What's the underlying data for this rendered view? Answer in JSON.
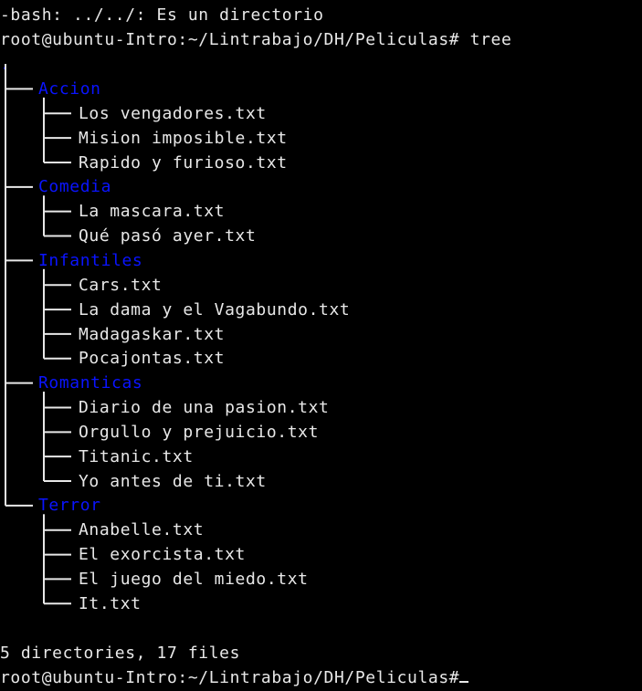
{
  "terminal": {
    "lines": {
      "bash_error": "-bash: ../../: Es un directorio",
      "prompt1": "root@ubuntu-Intro:~/Lintrabajo/DH/Peliculas# tree",
      "root_dot": ".",
      "summary": "5 directories, 17 files",
      "prompt2": "root@ubuntu-Intro:~/Lintrabajo/DH/Peliculas#"
    },
    "tree": {
      "dirs": [
        {
          "name": "Accion",
          "files": [
            "Los vengadores.txt",
            "Mision imposible.txt",
            "Rapido y furioso.txt"
          ]
        },
        {
          "name": "Comedia",
          "files": [
            "La mascara.txt",
            "Qué pasó ayer.txt"
          ]
        },
        {
          "name": "Infantiles",
          "files": [
            "Cars.txt",
            "La dama y el Vagabundo.txt",
            "Madagaskar.txt",
            "Pocajontas.txt"
          ]
        },
        {
          "name": "Romanticas",
          "files": [
            "Diario de una pasion.txt",
            "Orgullo y prejuicio.txt",
            "Titanic.txt",
            "Yo antes de ti.txt"
          ]
        },
        {
          "name": "Terror",
          "files": [
            "Anabelle.txt",
            "El exorcista.txt",
            "El juego del miedo.txt",
            "It.txt"
          ]
        }
      ]
    },
    "colors": {
      "background": "#000000",
      "foreground": "#e8e8e8",
      "directory": "#0a14ff"
    }
  }
}
